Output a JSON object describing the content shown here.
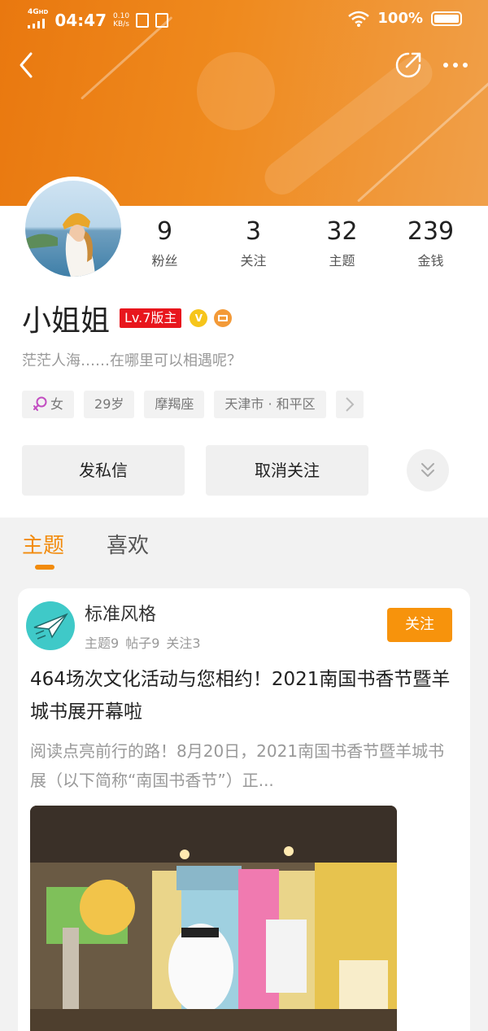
{
  "status_bar": {
    "network": "4G",
    "network_sub": "HD",
    "time": "04:47",
    "speed_value": "0.10",
    "speed_unit": "KB/s",
    "battery": "100%"
  },
  "profile": {
    "stats": [
      {
        "value": "9",
        "label": "粉丝"
      },
      {
        "value": "3",
        "label": "关注"
      },
      {
        "value": "32",
        "label": "主题"
      },
      {
        "value": "239",
        "label": "金钱"
      }
    ],
    "username": "小姐姐",
    "level_badge": "Lv.7版主",
    "verified_glyph": "V",
    "signature": "茫茫人海……在哪里可以相遇呢？",
    "tags": {
      "gender": "女",
      "age": "29岁",
      "zodiac": "摩羯座",
      "location": "天津市 · 和平区"
    },
    "message_button": "发私信",
    "unfollow_button": "取消关注"
  },
  "tabs": [
    {
      "label": "主题",
      "active": true
    },
    {
      "label": "喜欢",
      "active": false
    }
  ],
  "post": {
    "forum_name": "标准风格",
    "forum_stats": [
      "主题9",
      "帖子9",
      "关注3"
    ],
    "follow_button": "关注",
    "title": "464场次文化活动与您相约！2021南国书香节暨羊城书展开幕啦",
    "excerpt": "阅读点亮前行的路！8月20日，2021南国书香节暨羊城书展（以下简称“南国书香节”）正..."
  },
  "colors": {
    "header_orange": "#ef8a1e",
    "accent_orange": "#f28b0c",
    "level_red": "#e8161d",
    "follow_orange": "#f7930c"
  }
}
